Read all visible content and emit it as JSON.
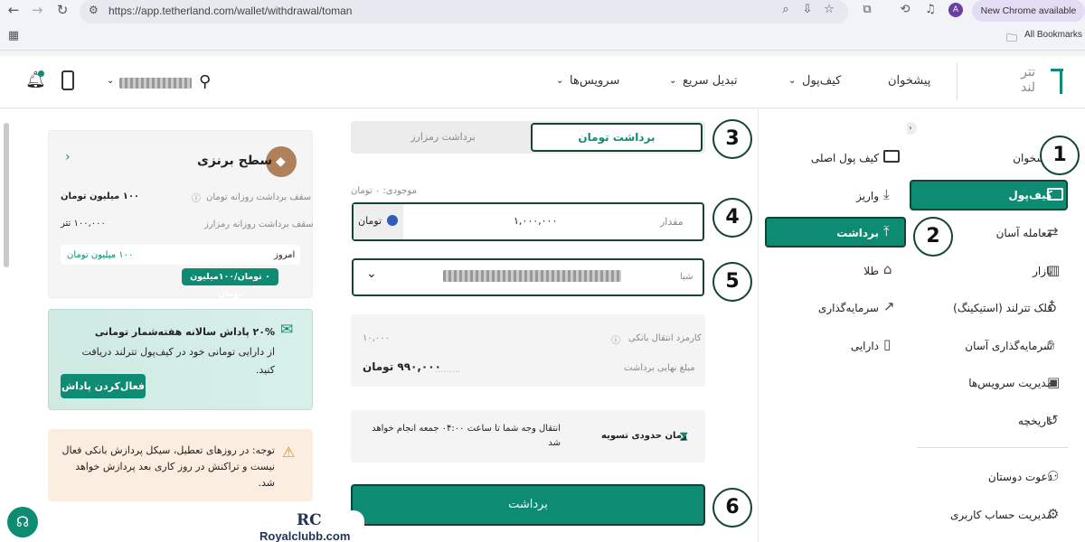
{
  "browser": {
    "url": "https://app.tetherland.com/wallet/withdrawal/toman",
    "new_chrome": "New Chrome available",
    "all_bookmarks": "All Bookmarks",
    "profile_initial": "A"
  },
  "header": {
    "logo_text": "تتر\nلند",
    "nav": [
      "پیشخوان",
      "کیف‌پول",
      "تبدیل سریع",
      "سرویس‌ها"
    ]
  },
  "sidebar": {
    "items": [
      "پیشخوان",
      "کیف‌پول",
      "معامله آسان",
      "بازار",
      "قلک تترلند (استیکینگ)",
      "سرمایه‌گذاری آسان",
      "مدیریت سرویس‌ها",
      "تاریخچه",
      "دعوت دوستان",
      "مدیریت حساب کاربری"
    ]
  },
  "submenu": {
    "items": [
      "کیف پول اصلی",
      "واریز",
      "برداشت",
      "طلا",
      "سرمایه‌گذاری",
      "دارایی"
    ]
  },
  "withdraw": {
    "tab_toman": "برداشت تومان",
    "tab_crypto": "برداشت رمزارز",
    "balance": "موجودی: ۰ تومان",
    "amount_label": "مقدار",
    "amount_value": "۱,۰۰۰,۰۰۰",
    "currency": "تومان",
    "sheba_label": "شبا",
    "fee_label": "کارمزد انتقال بانکی",
    "fee_value": "۱۰,۰۰۰",
    "final_label": "مبلغ نهایی برداشت",
    "final_value": "۹۹۰,۰۰۰ تومان",
    "settle_label": "زمان حدودی تسویه",
    "settle_text": "انتقال وجه شما تا ساعت ۰۴:۰۰ جمعه انجام خواهد شد",
    "submit": "برداشت"
  },
  "level": {
    "title": "سطح برنزی",
    "daily_toman_label": "سقف برداشت روزانه تومان",
    "daily_toman_value": "۱۰۰ میلیون تومان",
    "daily_crypto_label": "سقف برداشت روزانه رمزارز",
    "daily_crypto_value": "۱۰۰,۰۰۰ تتر",
    "today_label": "امروز",
    "today_value": "۱۰۰ میلیون تومان",
    "usage": "۰ تومان/۱۰۰میلیون تومان"
  },
  "promo": {
    "text_bold": "۲۰% پاداش سالانه هفته‌شمار تومانی",
    "text": "از دارایی تومانی خود در کیف‌پول تترلند دریافت کنید.",
    "button": "فعال‌کردن پاداش"
  },
  "notice": {
    "text": "توجه: در روزهای تعطیل، سیکل پردازش بانکی فعال نیست و تراکنش در روز کاری بعد پردازش خواهد شد."
  },
  "watermark": {
    "brand": "Royalclubb.com",
    "logo": "RC"
  },
  "callouts": [
    "1",
    "2",
    "3",
    "4",
    "5",
    "6"
  ],
  "colors": {
    "accent": "#0e8c73",
    "callout_border": "#134338"
  }
}
